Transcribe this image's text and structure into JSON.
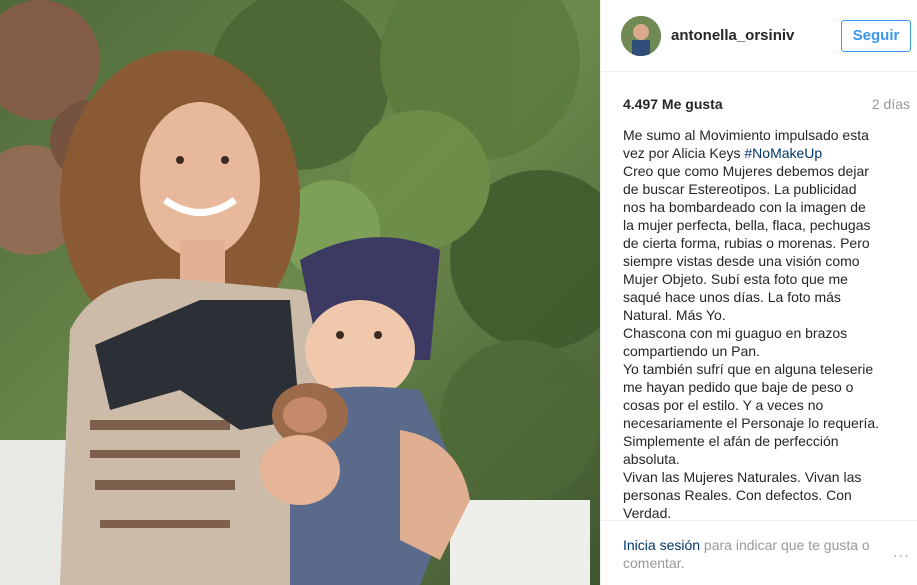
{
  "post": {
    "username": "antonella_orsiniv",
    "follow_label": "Seguir",
    "likes": "4.497 Me gusta",
    "time": "2 días",
    "caption_lines": {
      "l1": "Me sumo al Movimiento impulsado esta",
      "l2_pre": "vez por Alicia Keys ",
      "l2_tag": "#NoMakeUp",
      "l3": "Creo que como Mujeres debemos dejar",
      "l4": "de buscar Estereotipos. La publicidad",
      "l5": "nos ha bombardeado con la imagen de",
      "l6": "la mujer perfecta, bella, flaca, pechugas",
      "l7": "de cierta forma, rubias o morenas. Pero",
      "l8": "siempre vistas desde una visión como",
      "l9": "Mujer Objeto. Subí esta foto que me",
      "l10": "saqué hace unos días. La foto más",
      "l11": "Natural. Más Yo.",
      "l12": "Chascona con mi guaguo en brazos",
      "l13": "compartiendo un Pan.",
      "l14": "Yo también sufrí que en alguna teleserie",
      "l15": "me hayan pedido que baje de peso o",
      "l16": "cosas por el estilo. Y a veces no",
      "l17": "necesariamente el Personaje lo requería.",
      "l18": "Simplemente el afán de perfección",
      "l19": "absoluta.",
      "l20": "Vivan las Mujeres Naturales. Vivan las",
      "l21": "personas Reales. Con defectos. Con",
      "l22": "Verdad."
    }
  },
  "footer": {
    "login_link": "Inicia sesión",
    "login_text": " para indicar que te gusta o comentar.",
    "more_icon": "ellipsis-icon",
    "more_glyph": "···"
  },
  "colors": {
    "link": "#3897f0",
    "hashtag": "#003569",
    "muted": "#999999"
  }
}
